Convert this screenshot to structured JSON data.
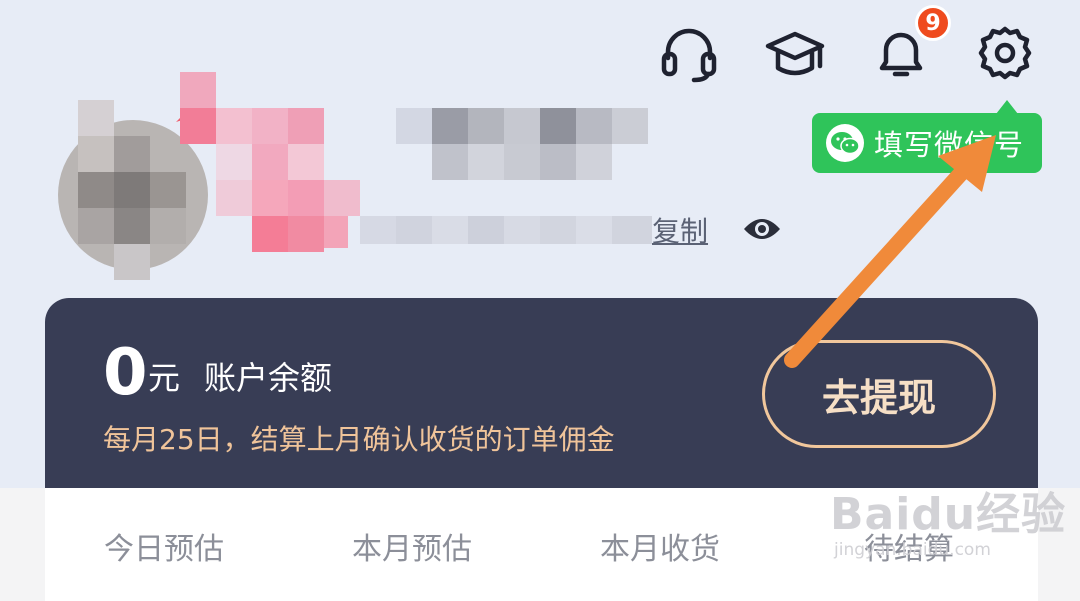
{
  "header": {
    "icons": [
      "headset-icon",
      "graduation-cap-icon",
      "bell-icon",
      "gear-icon"
    ],
    "notification_count": "9"
  },
  "wechat_tip": {
    "label": "填写微信号"
  },
  "profile": {
    "copy_label": "复制"
  },
  "balance": {
    "amount": "0",
    "currency": "元",
    "label": "账户余额",
    "settlement_note": "每月25日，结算上月确认收货的订单佣金",
    "withdraw_label": "去提现"
  },
  "stats": {
    "items": [
      "今日预估",
      "本月预估",
      "本月收货",
      "待结算"
    ]
  },
  "watermark": {
    "brand": "Baidu经验",
    "url": "jingyan.baidu.com"
  },
  "colors": {
    "page_bg": "#e7ecf6",
    "card_bg": "#383d55",
    "accent_gold": "#f0c49a",
    "wechat_green": "#2fc45a",
    "badge_red": "#ef4b1e",
    "arrow_orange": "#f08a3a"
  }
}
